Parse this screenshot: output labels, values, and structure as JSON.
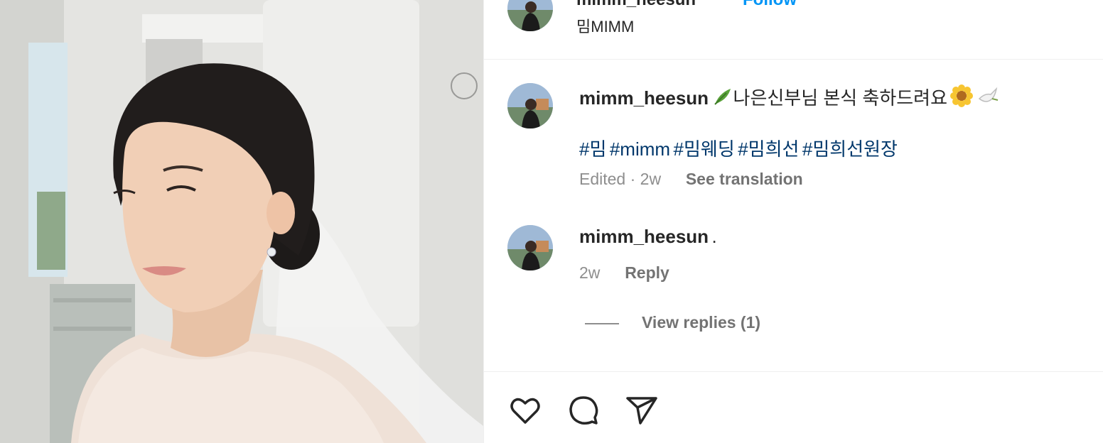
{
  "post": {
    "author": "mimm_heesun",
    "follow_label": "Follow",
    "subtitle": "밈MIMM"
  },
  "comments": [
    {
      "username": "mimm_heesun",
      "text": "나은신부님 본식 축하드려요",
      "hashtags": [
        "#밈",
        "#mimm",
        "#밈웨딩",
        "#밈희선",
        "#밈희선원장"
      ],
      "time": "Edited · 2w",
      "translate_label": "See translation"
    },
    {
      "username": "mimm_heesun",
      "text": ".",
      "time": "2w",
      "reply_label": "Reply",
      "view_replies_label": "View replies (1)"
    }
  ],
  "actions": {
    "like_icon": "heart-icon",
    "comment_icon": "comment-icon",
    "share_icon": "share-icon"
  },
  "colors": {
    "link_blue": "#0095f6",
    "hashtag": "#00376b",
    "muted": "#8e8e8e"
  }
}
